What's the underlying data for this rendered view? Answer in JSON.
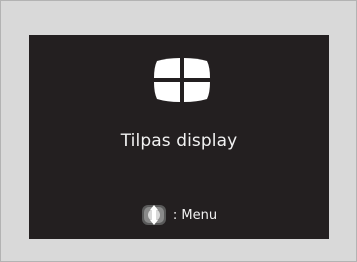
{
  "screen": {
    "icon": "display-adjust-icon",
    "title": "Tilpas display",
    "hint": {
      "icon": "selector-joystick-icon",
      "label": ": Menu"
    }
  },
  "colors": {
    "screen_background": "#231f20",
    "text": "#f2f2f2",
    "frame_background": "#d9d9d9"
  }
}
